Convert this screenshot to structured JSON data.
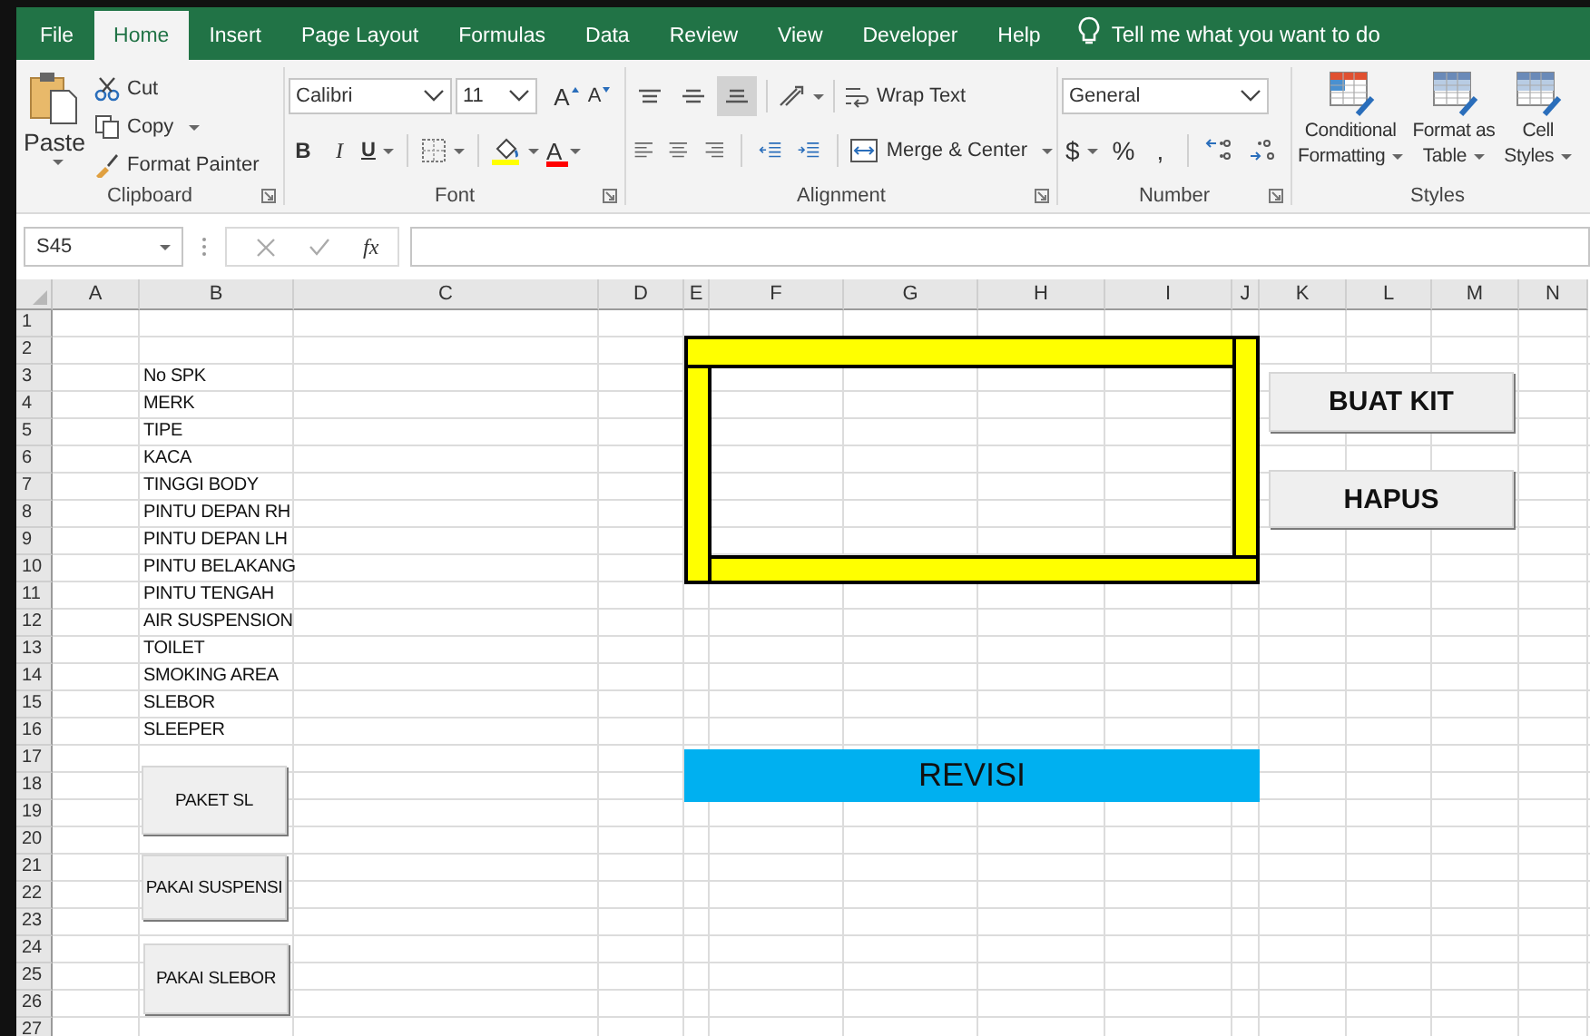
{
  "tabs": [
    {
      "label": "File",
      "selected": false
    },
    {
      "label": "Home",
      "selected": true
    },
    {
      "label": "Insert",
      "selected": false
    },
    {
      "label": "Page Layout",
      "selected": false
    },
    {
      "label": "Formulas",
      "selected": false
    },
    {
      "label": "Data",
      "selected": false
    },
    {
      "label": "Review",
      "selected": false
    },
    {
      "label": "View",
      "selected": false
    },
    {
      "label": "Developer",
      "selected": false
    },
    {
      "label": "Help",
      "selected": false
    }
  ],
  "tell_me": "Tell me what you want to do",
  "clipboard": {
    "paste": "Paste",
    "cut": "Cut",
    "copy": "Copy",
    "format_painter": "Format Painter",
    "label": "Clipboard"
  },
  "font": {
    "name": "Calibri",
    "size": "11",
    "grow": "A",
    "shrink": "A",
    "bold": "B",
    "italic": "I",
    "underline": "U",
    "font_color": "A",
    "label": "Font"
  },
  "alignment": {
    "vertical": [
      {
        "selected": false
      },
      {
        "selected": false
      },
      {
        "selected": true
      }
    ],
    "wrap_text": "Wrap Text",
    "merge_center": "Merge & Center",
    "label": "Alignment"
  },
  "number": {
    "format": "General",
    "currency": "$",
    "percent": "%",
    "comma": ",",
    "label": "Number"
  },
  "styles": {
    "buttons": [
      {
        "lines": [
          "Conditional",
          "Formatting"
        ]
      },
      {
        "lines": [
          "Format as",
          "Table"
        ]
      },
      {
        "lines": [
          "Cell",
          "Styles"
        ]
      }
    ],
    "label": "Styles"
  },
  "formula_bar": {
    "name_box": "S45",
    "fx": "fx"
  },
  "sheet": {
    "columns": [
      "A",
      "B",
      "C",
      "D",
      "E",
      "F",
      "G",
      "H",
      "I",
      "J",
      "K",
      "L",
      "M",
      "N"
    ],
    "rows": [
      {
        "number": "1"
      },
      {
        "number": "2"
      },
      {
        "number": "3",
        "column_b": "No SPK"
      },
      {
        "number": "4",
        "column_b": "MERK"
      },
      {
        "number": "5",
        "column_b": "TIPE"
      },
      {
        "number": "6",
        "column_b": "KACA"
      },
      {
        "number": "7",
        "column_b": "TINGGI BODY"
      },
      {
        "number": "8",
        "column_b": "PINTU DEPAN RH"
      },
      {
        "number": "9",
        "column_b": "PINTU DEPAN LH"
      },
      {
        "number": "10",
        "column_b": "PINTU BELAKANG"
      },
      {
        "number": "11",
        "column_b": "PINTU TENGAH"
      },
      {
        "number": "12",
        "column_b": "AIR SUSPENSION"
      },
      {
        "number": "13",
        "column_b": "TOILET"
      },
      {
        "number": "14",
        "column_b": "SMOKING AREA"
      },
      {
        "number": "15",
        "column_b": "SLEBOR"
      },
      {
        "number": "16",
        "column_b": "SLEEPER"
      },
      {
        "number": "17"
      },
      {
        "number": "18"
      },
      {
        "number": "19"
      },
      {
        "number": "20"
      },
      {
        "number": "21"
      },
      {
        "number": "22"
      },
      {
        "number": "23"
      },
      {
        "number": "24"
      },
      {
        "number": "25"
      },
      {
        "number": "26"
      },
      {
        "number": "27"
      }
    ]
  },
  "form_buttons": [
    {
      "label": "BUAT KIT",
      "kind": "large"
    },
    {
      "label": "HAPUS",
      "kind": "large"
    },
    {
      "label": "PAKET SL",
      "kind": "small"
    },
    {
      "label": "PAKAI SUSPENSI",
      "kind": "small"
    },
    {
      "label": "PAKAI SLEBOR",
      "kind": "small"
    }
  ],
  "banner": {
    "text": "REVISI"
  }
}
